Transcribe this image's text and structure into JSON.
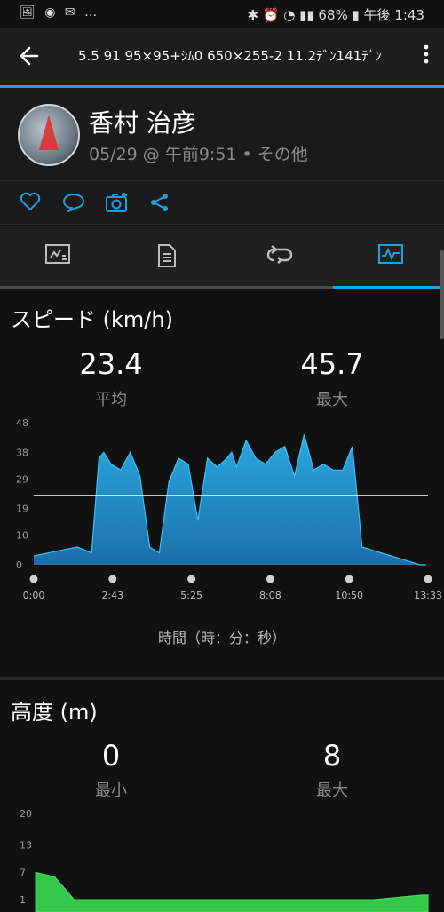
{
  "status_bar": {
    "left": "🖼 ◉ ✉ …",
    "right": "✱ ⏰ ◔ ▮▮ 68% ▮ 午後 1:43"
  },
  "app_bar": {
    "title": "5.5 91 95×95+ｼﾑ0 650×255-2 11.2ﾃﾞﾝ141ﾃﾞﾝ"
  },
  "profile": {
    "name": "香村 治彦",
    "meta": "05/29 @ 午前9:51 • その他"
  },
  "icons": {
    "like": "heart-icon",
    "comment": "comment-icon",
    "photo": "camera-plus-icon",
    "share": "share-icon",
    "tabs": [
      "overview-icon",
      "details-icon",
      "laps-icon",
      "charts-icon"
    ]
  },
  "speed": {
    "title": "スピード (km/h)",
    "avg_value": "23.4",
    "avg_label": "平均",
    "max_value": "45.7",
    "max_label": "最大",
    "axis_caption": "時間（時：分：秒）"
  },
  "elevation": {
    "title": "高度 (m)",
    "min_value": "0",
    "min_label": "最小",
    "max_value": "8",
    "max_label": "最大"
  },
  "colors": {
    "accent": "#1aa0e0",
    "speed_fill_top": "#29a8df",
    "speed_fill_bottom": "#1c6fa8",
    "elev_fill": "#34c74a"
  },
  "chart_data": [
    {
      "type": "area",
      "ylabel": "スピード (km/h)",
      "xlabel": "時間（時：分：秒）",
      "x_ticks": [
        "0:00",
        "2:43",
        "5:25",
        "8:08",
        "10:50",
        "13:33"
      ],
      "y_ticks": [
        "0",
        "10",
        "19",
        "29",
        "38",
        "48"
      ],
      "ylim": [
        0,
        48
      ],
      "xlim_seconds": [
        0,
        813
      ],
      "avg_line": 23.4,
      "x": [
        0,
        60,
        90,
        105,
        120,
        135,
        145,
        160,
        180,
        200,
        220,
        240,
        260,
        280,
        300,
        320,
        340,
        360,
        380,
        400,
        410,
        420,
        440,
        460,
        480,
        500,
        520,
        540,
        560,
        580,
        600,
        620,
        640,
        660,
        680,
        700,
        720,
        740,
        760,
        780,
        800,
        813
      ],
      "y": [
        3,
        5,
        6,
        5,
        4,
        36,
        38,
        34,
        32,
        38,
        30,
        6,
        4,
        28,
        36,
        34,
        15,
        36,
        33,
        36,
        38,
        33,
        42,
        36,
        34,
        38,
        40,
        30,
        44,
        32,
        34,
        32,
        32,
        40,
        6,
        5,
        4,
        3,
        2,
        1,
        0,
        0
      ]
    },
    {
      "type": "area",
      "ylabel": "高度 (m)",
      "y_ticks": [
        "1",
        "7",
        "13",
        "20"
      ],
      "ylim": [
        1,
        20
      ],
      "x": [
        0,
        40,
        80,
        150,
        400,
        700,
        800,
        813
      ],
      "y": [
        7,
        6,
        1,
        1,
        1,
        1,
        2,
        2
      ]
    }
  ]
}
